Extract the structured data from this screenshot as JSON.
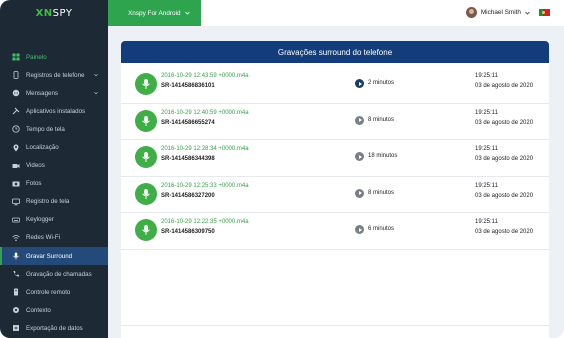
{
  "brand": {
    "prefix": "XN",
    "name": "SPY"
  },
  "device": {
    "label": "Xnspy For Android"
  },
  "user": {
    "name": "Michael Smith"
  },
  "sidebar": {
    "items": [
      {
        "label": "Painelo",
        "icon": "dashboard-icon",
        "state": "active-green"
      },
      {
        "label": "Registros de telefone",
        "icon": "phone-icon",
        "caret": true
      },
      {
        "label": "Mensagens",
        "icon": "chat-icon",
        "caret": true
      },
      {
        "label": "Aplicativos instalados",
        "icon": "tools-icon"
      },
      {
        "label": "Tempo de tela",
        "icon": "clock-icon"
      },
      {
        "label": "Localização",
        "icon": "location-icon"
      },
      {
        "label": "Videos",
        "icon": "video-icon"
      },
      {
        "label": "Fotos",
        "icon": "photo-icon"
      },
      {
        "label": "Registro de tela",
        "icon": "screen-icon"
      },
      {
        "label": "Keylogger",
        "icon": "keyboard-icon"
      },
      {
        "label": "Redes Wi-Fi",
        "icon": "wifi-icon"
      },
      {
        "label": "Gravar Surround",
        "icon": "mic-icon",
        "state": "selected"
      },
      {
        "label": "Gravação de chamadas",
        "icon": "call-record-icon"
      },
      {
        "label": "Controle remoto",
        "icon": "remote-icon"
      },
      {
        "label": "Contexto",
        "icon": "settings-icon"
      },
      {
        "label": "Exportação de datos",
        "icon": "export-icon"
      }
    ]
  },
  "panel": {
    "title": "Gravações surround do telefone"
  },
  "recordings": [
    {
      "file": "2016-10-29 12:43:59 +0000.m4a",
      "sr": "SR-1414586836101",
      "duration": "2 minutos",
      "time": "19:25:11",
      "date": "03 de agosto de 2020",
      "playing": true
    },
    {
      "file": "2016-10-29 12:40:59 +0000.m4a",
      "sr": "SR-1414586655274",
      "duration": "8 minutos",
      "time": "19:25:11",
      "date": "03 de agosto de 2020",
      "playing": false
    },
    {
      "file": "2016-10-29 12:28:34 +0000.m4a",
      "sr": "SR-1414586344398",
      "duration": "18 minutos",
      "time": "19:25:11",
      "date": "03 de agosto de 2020",
      "playing": false
    },
    {
      "file": "2016-10-29 12:25:33 +0000.m4a",
      "sr": "SR-1414586327200",
      "duration": "8 minutos",
      "time": "19:25:11",
      "date": "03 de agosto de 2020",
      "playing": false
    },
    {
      "file": "2016-10-29 12:22:35 +0000.m4a",
      "sr": "SR-1414586309750",
      "duration": "6 minutos",
      "time": "19:25:11",
      "date": "03 de agosto de 2020",
      "playing": false
    }
  ],
  "colors": {
    "sidebar": "#1d2a36",
    "accent": "#2ea44f",
    "header": "#123d7a",
    "selected": "#234a78"
  }
}
